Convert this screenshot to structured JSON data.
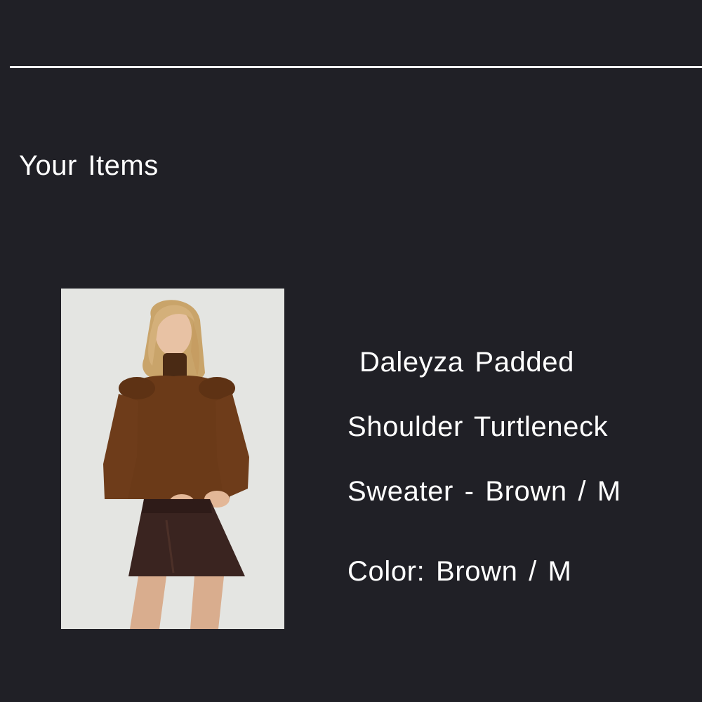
{
  "cart": {
    "section_title": "Your Items",
    "items": [
      {
        "title_lines": [
          "Daleyza Padded",
          "Shoulder Turtleneck",
          "Sweater - Brown / M"
        ],
        "color_label": "Color:",
        "color_value": "Brown / M",
        "image_icon": "product-photo"
      }
    ]
  },
  "colors": {
    "background": "#202026",
    "text": "#ffffff",
    "divider": "#f4f4f4"
  }
}
